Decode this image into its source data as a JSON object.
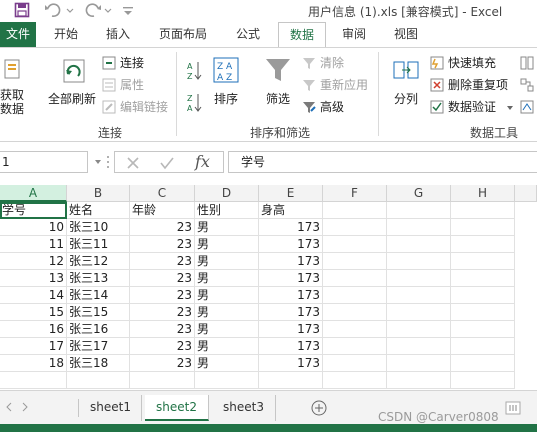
{
  "title": "用户信息 (1).xls  [兼容模式] - Excel",
  "tabs": [
    "文件",
    "开始",
    "插入",
    "页面布局",
    "公式",
    "数据",
    "审阅",
    "视图"
  ],
  "ribbon": {
    "get_data": "获取\n数据",
    "refresh_all": "全部刷新",
    "connections": "连接",
    "properties": "属性",
    "edit_links": "编辑链接",
    "sort": "排序",
    "filter": "筛选",
    "clear": "清除",
    "reapply": "重新应用",
    "advanced": "高级",
    "split": "分列",
    "flash_fill": "快速填充",
    "remove_duplicates": "删除重复项",
    "data_validation": "数据验证",
    "group_connections": "连接",
    "group_sort_filter": "排序和筛选",
    "group_data_tools": "数据工具"
  },
  "formula_bar": {
    "name_box": "1",
    "fx": "fx",
    "content": "学号"
  },
  "columns": [
    "A",
    "B",
    "C",
    "D",
    "E",
    "F",
    "G",
    "H"
  ],
  "headers": [
    "学号",
    "姓名",
    "年龄",
    "性别",
    "身高"
  ],
  "rows": [
    [
      "10",
      "张三10",
      "23",
      "男",
      "173"
    ],
    [
      "11",
      "张三11",
      "23",
      "男",
      "173"
    ],
    [
      "12",
      "张三12",
      "23",
      "男",
      "173"
    ],
    [
      "13",
      "张三13",
      "23",
      "男",
      "173"
    ],
    [
      "14",
      "张三14",
      "23",
      "男",
      "173"
    ],
    [
      "15",
      "张三15",
      "23",
      "男",
      "173"
    ],
    [
      "16",
      "张三16",
      "23",
      "男",
      "173"
    ],
    [
      "17",
      "张三17",
      "23",
      "男",
      "173"
    ],
    [
      "18",
      "张三18",
      "23",
      "男",
      "173"
    ]
  ],
  "sheets": [
    "sheet1",
    "sheet2",
    "sheet3"
  ],
  "active_sheet": "sheet2",
  "watermark": "CSDN @Carver0808",
  "colors": {
    "accent": "#217346"
  }
}
